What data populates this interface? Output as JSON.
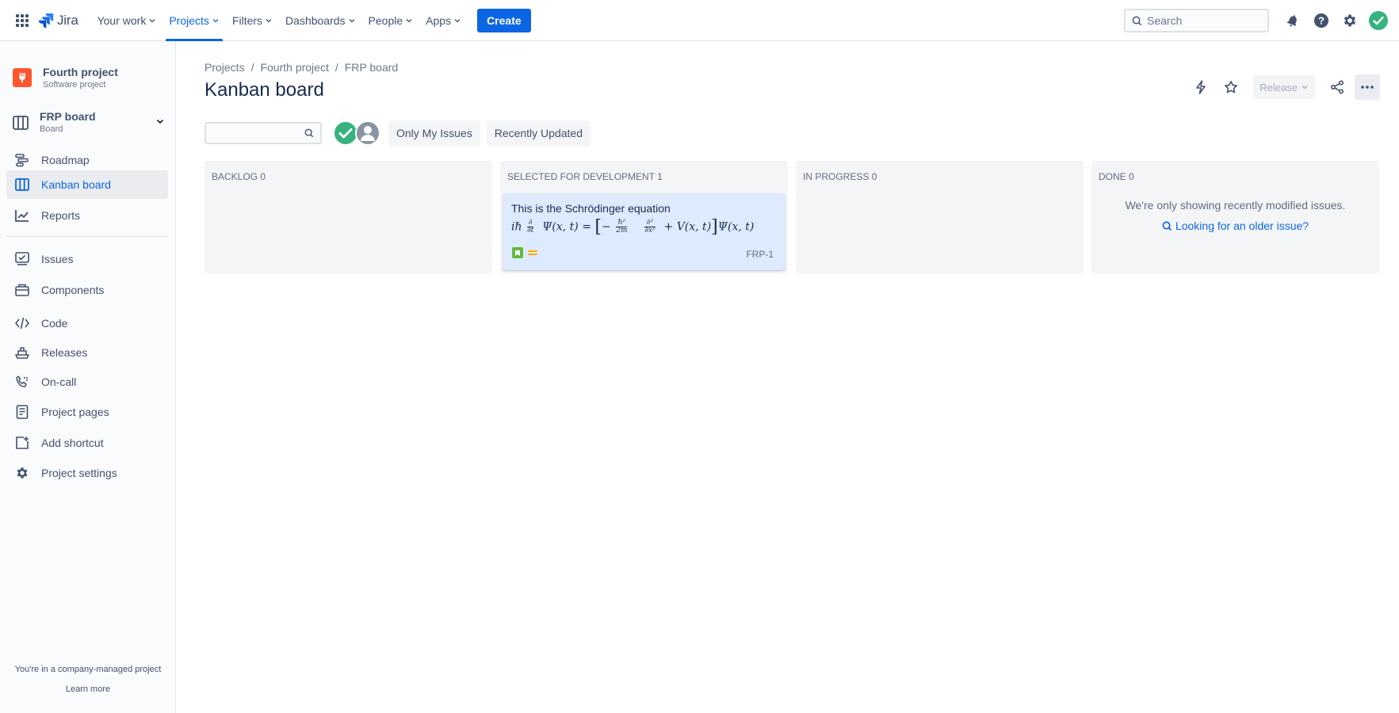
{
  "topnav": {
    "logo_text": "Jira",
    "items": [
      {
        "label": "Your work"
      },
      {
        "label": "Projects"
      },
      {
        "label": "Filters"
      },
      {
        "label": "Dashboards"
      },
      {
        "label": "People"
      },
      {
        "label": "Apps"
      }
    ],
    "active_item": "Projects",
    "create_label": "Create",
    "search_placeholder": "Search"
  },
  "sidebar": {
    "project_name": "Fourth project",
    "project_type": "Software project",
    "board_name": "FRP board",
    "board_sub": "Board",
    "items": [
      {
        "label": "Roadmap",
        "icon": "roadmap-icon"
      },
      {
        "label": "Kanban board",
        "icon": "board-icon",
        "active": true
      },
      {
        "label": "Reports",
        "icon": "chart-icon"
      },
      {
        "label": "Issues",
        "icon": "issues-icon"
      },
      {
        "label": "Components",
        "icon": "component-icon"
      },
      {
        "label": "Code",
        "icon": "code-icon"
      },
      {
        "label": "Releases",
        "icon": "ship-icon"
      },
      {
        "label": "On-call",
        "icon": "phone-icon"
      },
      {
        "label": "Project pages",
        "icon": "page-icon"
      },
      {
        "label": "Add shortcut",
        "icon": "add-shortcut-icon"
      },
      {
        "label": "Project settings",
        "icon": "gear-icon"
      }
    ],
    "footer_text": "You're in a company-managed project",
    "footer_link": "Learn more"
  },
  "main": {
    "breadcrumb": [
      "Projects",
      "Fourth project",
      "FRP board"
    ],
    "title": "Kanban board",
    "release_label": "Release",
    "filters": {
      "only_my_issues": "Only My Issues",
      "recently_updated": "Recently Updated"
    },
    "columns": [
      {
        "name": "BACKLOG",
        "count": "0"
      },
      {
        "name": "SELECTED FOR DEVELOPMENT",
        "count": "1"
      },
      {
        "name": "IN PROGRESS",
        "count": "0"
      },
      {
        "name": "DONE",
        "count": "0"
      }
    ],
    "card": {
      "title": "This is the Schrödinger equation",
      "key": "FRP-1",
      "issue_type": "story",
      "priority": "medium"
    },
    "done_message": "We're only showing recently modified issues.",
    "done_link": "Looking for an older issue?"
  },
  "colors": {
    "accent": "#0c66e4",
    "card_bg": "#deebff",
    "column_bg": "#f4f5f7",
    "story_green": "#63ba3c",
    "priority_medium": "#ffab00"
  }
}
